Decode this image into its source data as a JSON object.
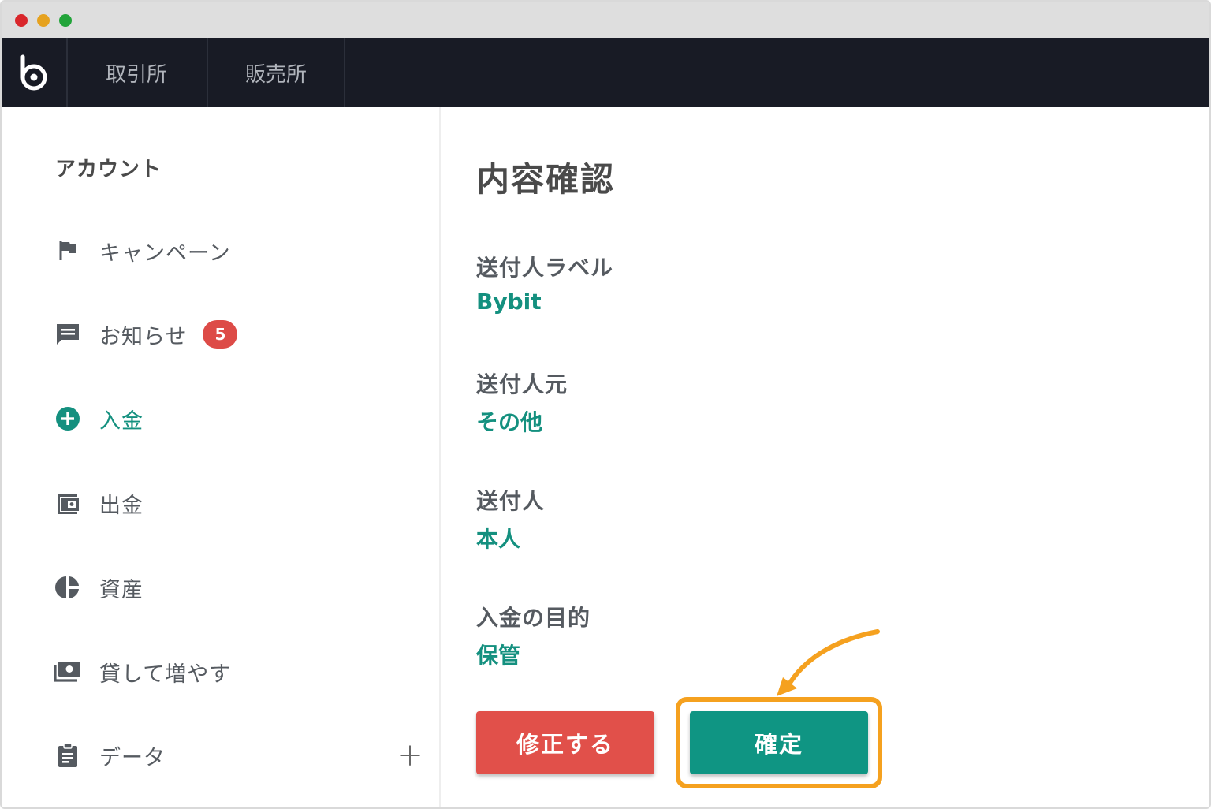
{
  "window": {
    "controls": [
      "close",
      "minimize",
      "maximize"
    ]
  },
  "navbar": {
    "logo_icon": "bitbank-logo-icon",
    "tabs": [
      {
        "label": "取引所"
      },
      {
        "label": "販売所"
      }
    ]
  },
  "sidebar": {
    "title": "アカウント",
    "items": [
      {
        "label": "キャンペーン",
        "icon": "flag-icon"
      },
      {
        "label": "お知らせ",
        "icon": "message-icon",
        "badge": "5"
      },
      {
        "label": "入金",
        "icon": "plus-circle-icon",
        "active": true
      },
      {
        "label": "出金",
        "icon": "wallet-icon"
      },
      {
        "label": "資産",
        "icon": "pie-chart-icon"
      },
      {
        "label": "貸して増やす",
        "icon": "cash-icon"
      },
      {
        "label": "データ",
        "icon": "clipboard-icon",
        "expand": "+"
      }
    ]
  },
  "main": {
    "title": "内容確認",
    "fields": [
      {
        "label": "送付人ラベル",
        "value": "Bybit"
      },
      {
        "label": "送付人元",
        "value": "その他"
      },
      {
        "label": "送付人",
        "value": "本人"
      },
      {
        "label": "入金の目的",
        "value": "保管"
      }
    ],
    "buttons": {
      "edit": "修正する",
      "confirm": "確定"
    }
  },
  "colors": {
    "accent": "#14907f",
    "danger": "#e1504a",
    "highlight": "#f5a11f",
    "navbar": "#181b25"
  }
}
